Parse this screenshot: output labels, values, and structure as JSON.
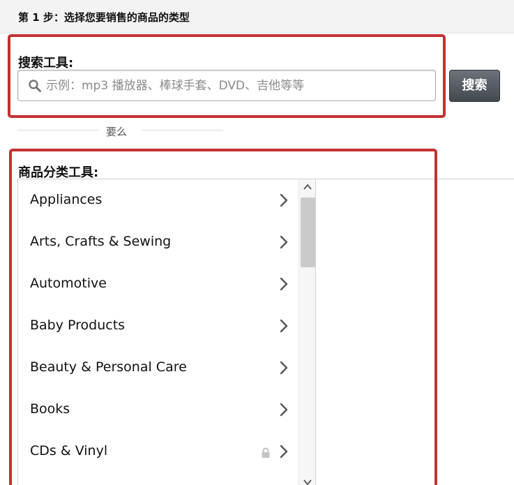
{
  "step": {
    "title": "第 1 步：选择您要销售的商品的类型"
  },
  "search": {
    "label": "搜索工具:",
    "placeholder": "示例：mp3 播放器、棒球手套、DVD、吉他等等",
    "value": "",
    "button_label": "搜索"
  },
  "divider": {
    "text": "要么"
  },
  "categories": {
    "label": "商品分类工具:",
    "items": [
      {
        "label": "Appliances",
        "locked": false
      },
      {
        "label": "Arts, Crafts & Sewing",
        "locked": false
      },
      {
        "label": "Automotive",
        "locked": false
      },
      {
        "label": "Baby Products",
        "locked": false
      },
      {
        "label": "Beauty & Personal Care",
        "locked": false
      },
      {
        "label": "Books",
        "locked": false
      },
      {
        "label": "CDs & Vinyl",
        "locked": true
      }
    ]
  },
  "colors": {
    "highlight": "#c43131",
    "button": "#54585f",
    "header_bg": "#f3f3f3"
  },
  "icons": {
    "search": "search-icon",
    "chevron": "chevron-right-icon",
    "lock": "lock-icon"
  }
}
